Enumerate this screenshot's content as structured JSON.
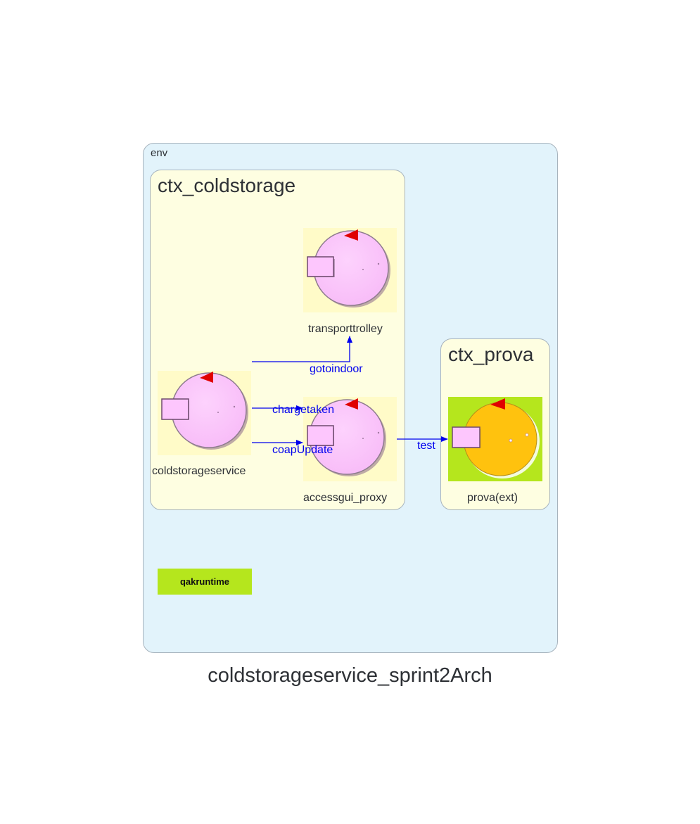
{
  "diagram": {
    "title": "coldstorageservice_sprint2Arch",
    "env": {
      "label": "env"
    },
    "contexts": [
      {
        "label": "ctx_coldstorage"
      },
      {
        "label": "ctx_prova"
      }
    ],
    "actors": [
      {
        "label": "transporttrolley",
        "context": "ctx_coldstorage",
        "style": "internal"
      },
      {
        "label": "coldstorageservice",
        "context": "ctx_coldstorage",
        "style": "internal"
      },
      {
        "label": "accessgui_proxy",
        "context": "ctx_coldstorage",
        "style": "internal"
      },
      {
        "label": "prova(ext)",
        "context": "ctx_prova",
        "style": "external"
      }
    ],
    "edges": [
      {
        "label": "gotoindoor",
        "from": "coldstorageservice",
        "to": "transporttrolley"
      },
      {
        "label": "chargetaken",
        "from": "coldstorageservice",
        "to": "accessgui_proxy"
      },
      {
        "label": "coapUpdate",
        "from": "coldstorageservice",
        "to": "accessgui_proxy"
      },
      {
        "label": "test",
        "from": "accessgui_proxy",
        "to": "prova(ext)"
      }
    ],
    "runtime_badge": "qakruntime",
    "colors": {
      "env_bg": "#e2f3fb",
      "context_bg": "#fefee1",
      "edge": "#0000ee",
      "actor_pink": "#fdc6fd",
      "actor_orange": "#ffc20e",
      "external_bg": "#b5e61d",
      "marker": "#e00000"
    }
  }
}
